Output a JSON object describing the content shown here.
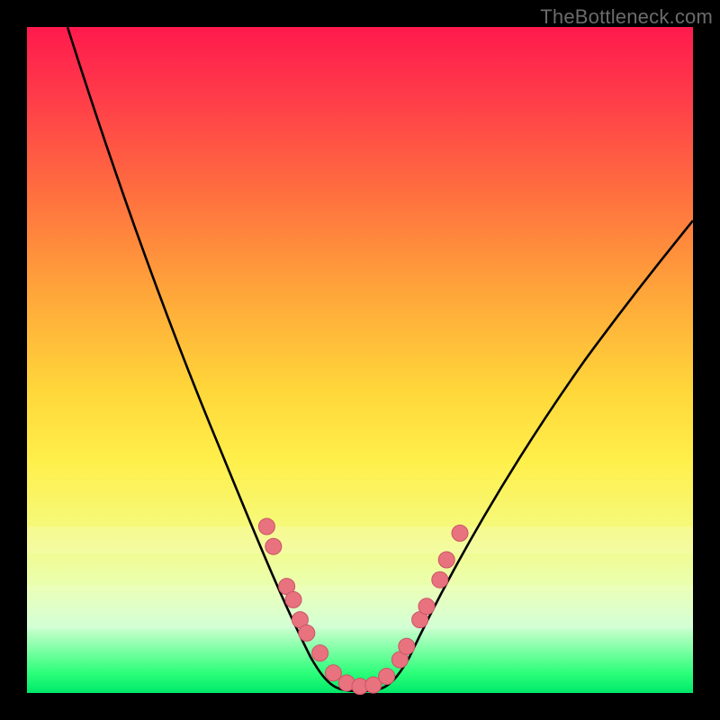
{
  "watermark": "TheBottleneck.com",
  "colors": {
    "frame": "#000000",
    "gradient_top": "#ff1a4d",
    "gradient_mid": "#ffd83a",
    "gradient_bottom": "#00e86a",
    "curve": "#000000",
    "dot_fill": "#e9727f",
    "dot_stroke": "#c95565"
  },
  "chart_data": {
    "type": "line",
    "title": "",
    "xlabel": "",
    "ylabel": "",
    "xlim": [
      0,
      100
    ],
    "ylim": [
      0,
      100
    ],
    "grid": false,
    "legend": false,
    "x": [
      0,
      3,
      7,
      11,
      15,
      19,
      23,
      27,
      30,
      33,
      36,
      38,
      40,
      42,
      44,
      46,
      48,
      50,
      52,
      54,
      56,
      59,
      62,
      65,
      69,
      73,
      77,
      82,
      88,
      94,
      100
    ],
    "curve_values": [
      100,
      94,
      86,
      78,
      70,
      62,
      54,
      46,
      39,
      32,
      26,
      21,
      16,
      11,
      7,
      4,
      2,
      1,
      1,
      2,
      5,
      10,
      16,
      22,
      29,
      36,
      43,
      50,
      57,
      63,
      68
    ],
    "markers": [
      {
        "x": 36,
        "y": 25
      },
      {
        "x": 37,
        "y": 22
      },
      {
        "x": 39,
        "y": 16
      },
      {
        "x": 40,
        "y": 14
      },
      {
        "x": 41,
        "y": 11
      },
      {
        "x": 42,
        "y": 9
      },
      {
        "x": 44,
        "y": 6
      },
      {
        "x": 46,
        "y": 3
      },
      {
        "x": 48,
        "y": 1.5
      },
      {
        "x": 50,
        "y": 1
      },
      {
        "x": 52,
        "y": 1.2
      },
      {
        "x": 54,
        "y": 2.5
      },
      {
        "x": 56,
        "y": 5
      },
      {
        "x": 57,
        "y": 7
      },
      {
        "x": 59,
        "y": 11
      },
      {
        "x": 60,
        "y": 13
      },
      {
        "x": 62,
        "y": 17
      },
      {
        "x": 63,
        "y": 20
      },
      {
        "x": 65,
        "y": 24
      }
    ],
    "notes": "Bottleneck-style V curve on a vertical red→green gradient. y=0 (green) at bottom, y=100 (red) at top. Values estimated from pixel positions."
  }
}
